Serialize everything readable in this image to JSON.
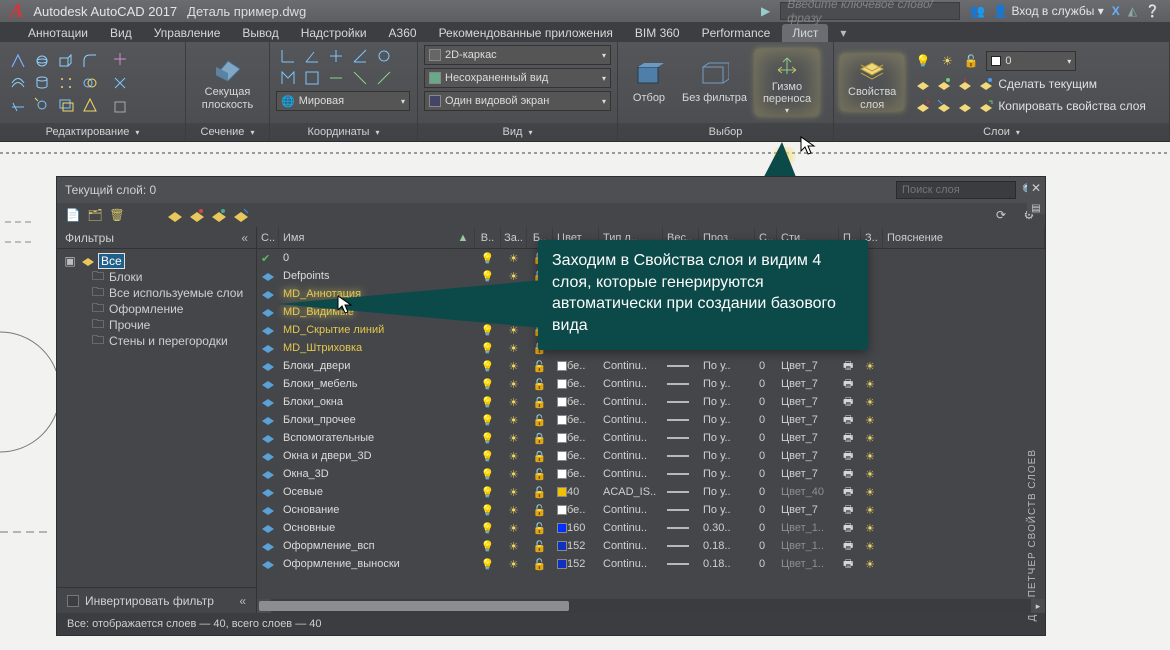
{
  "titlebar": {
    "app": "Autodesk AutoCAD 2017",
    "file": "Деталь пример.dwg",
    "search_placeholder": "Введите ключевое слово/фразу",
    "sign_in": "Вход в службы"
  },
  "tabs": [
    "Аннотации",
    "Вид",
    "Управление",
    "Вывод",
    "Надстройки",
    "A360",
    "Рекомендованные приложения",
    "BIM 360",
    "Performance",
    "Лист"
  ],
  "tabs_active": 9,
  "ribbon": {
    "panels": [
      {
        "label": "Редактирование",
        "arrow": true
      },
      {
        "label": "Сечение",
        "arrow": true
      },
      {
        "label": "Координаты",
        "arrow": true
      },
      {
        "label": "Вид",
        "arrow": true
      },
      {
        "label": "Выбор",
        "arrow": false
      },
      {
        "label": "Слои",
        "arrow": true
      }
    ],
    "combos": {
      "vstyle": "2D-каркас",
      "saved_view": "Несохраненный вид",
      "ucs": "Мировая",
      "viewport": "Один видовой экран"
    },
    "section_btn": "Секущая\nплоскость",
    "select": [
      "Отбор",
      "Без фильтра",
      "Гизмо\nпереноса",
      "Свойства\nслоя"
    ],
    "layer_links": [
      "Сделать текущим",
      "Копировать свойства слоя"
    ],
    "layer_combo": "0"
  },
  "palette": {
    "title": "Текущий слой: 0",
    "search_placeholder": "Поиск слоя",
    "filters_header": "Фильтры",
    "filters": {
      "root": "Все",
      "children": [
        "Блоки",
        "Все используемые слои",
        "Оформление",
        "Прочие",
        "Стены и перегородки"
      ]
    },
    "columns": [
      "С..",
      "Имя",
      "В..",
      "За..",
      "Б..",
      "Цвет",
      "Тип л..",
      "Вес..",
      "Проз..",
      "С..",
      "Сти..",
      "П..",
      "З..",
      "Пояснение"
    ],
    "invert": "Инвертировать фильтр",
    "status": "Все: отображается слоев — 40, всего слоев — 40",
    "vtitle": "ДИСПЕТЧЕР СВОЙСТВ СЛОЕВ",
    "rows": [
      {
        "st": "cur",
        "name": "0",
        "md": false
      },
      {
        "st": "",
        "name": "Defpoints",
        "md": false
      },
      {
        "st": "",
        "name": "MD_Аннотация",
        "md": true,
        "hl": true
      },
      {
        "st": "",
        "name": "MD_Видимые",
        "md": true,
        "hl": true
      },
      {
        "st": "",
        "name": "MD_Скрытие линий",
        "md": true
      },
      {
        "st": "",
        "name": "MD_Штриховка",
        "md": true
      },
      {
        "st": "",
        "name": "Блоки_двери",
        "color": "#ffffff",
        "ctxt": "бе..",
        "lt": "Continu..",
        "lw": "—",
        "tr": "По у..",
        "pw": "0",
        "ps": "Цвет_7"
      },
      {
        "st": "",
        "name": "Блоки_мебель",
        "color": "#ffffff",
        "ctxt": "бе..",
        "lt": "Continu..",
        "lw": "—",
        "tr": "По у..",
        "pw": "0",
        "ps": "Цвет_7"
      },
      {
        "st": "",
        "name": "Блоки_окна",
        "locked": true,
        "color": "#ffffff",
        "ctxt": "бе..",
        "lt": "Continu..",
        "lw": "—",
        "tr": "По у..",
        "pw": "0",
        "ps": "Цвет_7"
      },
      {
        "st": "",
        "name": "Блоки_прочее",
        "color": "#ffffff",
        "ctxt": "бе..",
        "lt": "Continu..",
        "lw": "—",
        "tr": "По у..",
        "pw": "0",
        "ps": "Цвет_7"
      },
      {
        "st": "",
        "name": "Вспомогательные",
        "locked": true,
        "color": "#ffffff",
        "ctxt": "бе..",
        "lt": "Continu..",
        "lw": "—",
        "tr": "По у..",
        "pw": "0",
        "ps": "Цвет_7"
      },
      {
        "st": "",
        "name": "Окна и двери_3D",
        "locked": true,
        "color": "#ffffff",
        "ctxt": "бе..",
        "lt": "Continu..",
        "lw": "—",
        "tr": "По у..",
        "pw": "0",
        "ps": "Цвет_7"
      },
      {
        "st": "",
        "name": "Окна_3D",
        "color": "#ffffff",
        "ctxt": "бе..",
        "lt": "Continu..",
        "lw": "—",
        "tr": "По у..",
        "pw": "0",
        "ps": "Цвет_7"
      },
      {
        "st": "",
        "name": "Осевые",
        "color": "#f0c000",
        "ctxt": "40",
        "lt": "ACAD_IS..",
        "lw": "—",
        "tr": "По у..",
        "pw": "0",
        "ps": "Цвет_40",
        "dimps": true
      },
      {
        "st": "",
        "name": "Основание",
        "color": "#ffffff",
        "ctxt": "бе..",
        "lt": "Continu..",
        "lw": "—",
        "tr": "По у..",
        "pw": "0",
        "ps": "Цвет_7"
      },
      {
        "st": "",
        "name": "Основные",
        "color": "#0030ff",
        "ctxt": "160",
        "lt": "Continu..",
        "lw": "—",
        "tr": "0.30..",
        "pw": "0",
        "ps": "Цвет_1..",
        "dimps": true
      },
      {
        "st": "",
        "name": "Оформление_всп",
        "color": "#1030c0",
        "ctxt": "152",
        "lt": "Continu..",
        "lw": "—",
        "tr": "0.18..",
        "pw": "0",
        "ps": "Цвет_1..",
        "dimps": true
      },
      {
        "st": "",
        "name": "Оформление_выноски",
        "color": "#1030c0",
        "ctxt": "152",
        "lt": "Continu..",
        "lw": "—",
        "tr": "0.18..",
        "pw": "0",
        "ps": "Цвет_1..",
        "dimps": true
      }
    ]
  },
  "callout_text": "Заходим в Свойства слоя и видим 4 слоя, которые генерируются автоматически при создании базового вида"
}
